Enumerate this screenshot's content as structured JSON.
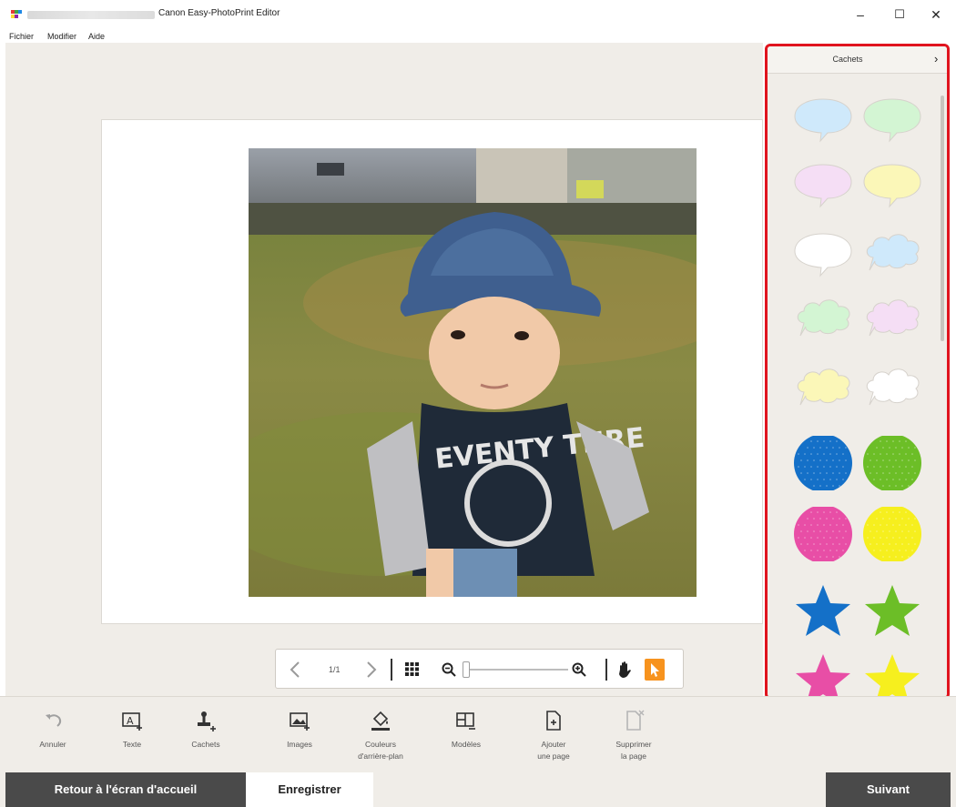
{
  "window": {
    "title": "Canon Easy-PhotoPrint Editor",
    "minimize_glyph": "–",
    "maximize_glyph": "☐",
    "close_glyph": "✕"
  },
  "menu": [
    "Fichier",
    "Modifier",
    "Aide"
  ],
  "navigation": {
    "page_indicator": "1/1"
  },
  "panel": {
    "title": "Cachets",
    "close_glyph": "›",
    "stamps": [
      {
        "name": "speech-bubble-blue",
        "shape": "bubble",
        "color": "#cfe9fb"
      },
      {
        "name": "speech-bubble-green",
        "shape": "bubble",
        "color": "#d3f5d3"
      },
      {
        "name": "speech-bubble-pink",
        "shape": "bubble",
        "color": "#f5def5"
      },
      {
        "name": "speech-bubble-yellow",
        "shape": "bubble",
        "color": "#fbf7b8"
      },
      {
        "name": "speech-bubble-white",
        "shape": "bubble",
        "color": "#ffffff"
      },
      {
        "name": "cloud-bubble-blue",
        "shape": "cloud",
        "color": "#cfe9fb"
      },
      {
        "name": "cloud-bubble-green",
        "shape": "cloud",
        "color": "#d3f5d3"
      },
      {
        "name": "cloud-bubble-pink",
        "shape": "cloud",
        "color": "#f5def5"
      },
      {
        "name": "cloud-bubble-yellow",
        "shape": "cloud",
        "color": "#fbf7b8"
      },
      {
        "name": "cloud-bubble-white",
        "shape": "cloud",
        "color": "#ffffff"
      },
      {
        "name": "dotted-circle-blue",
        "shape": "circle",
        "color": "#1470c8"
      },
      {
        "name": "dotted-circle-green",
        "shape": "circle",
        "color": "#6cbe27"
      },
      {
        "name": "dotted-circle-pink",
        "shape": "circle",
        "color": "#e84ea6"
      },
      {
        "name": "dotted-circle-yellow",
        "shape": "circle",
        "color": "#f6ef1e"
      },
      {
        "name": "star-blue",
        "shape": "star",
        "color": "#1470c8"
      },
      {
        "name": "star-green",
        "shape": "star",
        "color": "#6cbe27"
      },
      {
        "name": "star-pink",
        "shape": "star",
        "color": "#e84ea6"
      },
      {
        "name": "star-yellow",
        "shape": "star",
        "color": "#f6ef1e"
      }
    ]
  },
  "actions": [
    {
      "name": "undo",
      "label": "Annuler",
      "icon": "undo-icon",
      "enabled": false
    },
    {
      "name": "text",
      "label": "Texte",
      "icon": "text-icon",
      "enabled": true
    },
    {
      "name": "stamps",
      "label": "Cachets",
      "icon": "stamp-icon",
      "enabled": true
    },
    {
      "name": "images",
      "label": "Images",
      "icon": "image-icon",
      "enabled": true
    },
    {
      "name": "background-colors",
      "label": "Couleurs\nd'arrière-plan",
      "icon": "paint-bucket-icon",
      "enabled": true
    },
    {
      "name": "templates",
      "label": "Modèles",
      "icon": "template-icon",
      "enabled": true
    },
    {
      "name": "add-page",
      "label": "Ajouter\nune page",
      "icon": "add-page-icon",
      "enabled": true
    },
    {
      "name": "delete-page",
      "label": "Supprimer\nla page",
      "icon": "delete-page-icon",
      "enabled": false
    }
  ],
  "footer": {
    "home_label": "Retour à l'écran d'accueil",
    "save_label": "Enregistrer",
    "next_label": "Suivant"
  },
  "colors": {
    "accent": "#f7931e",
    "highlight_border": "#e0141e",
    "dark_button": "#4a4a4a"
  }
}
